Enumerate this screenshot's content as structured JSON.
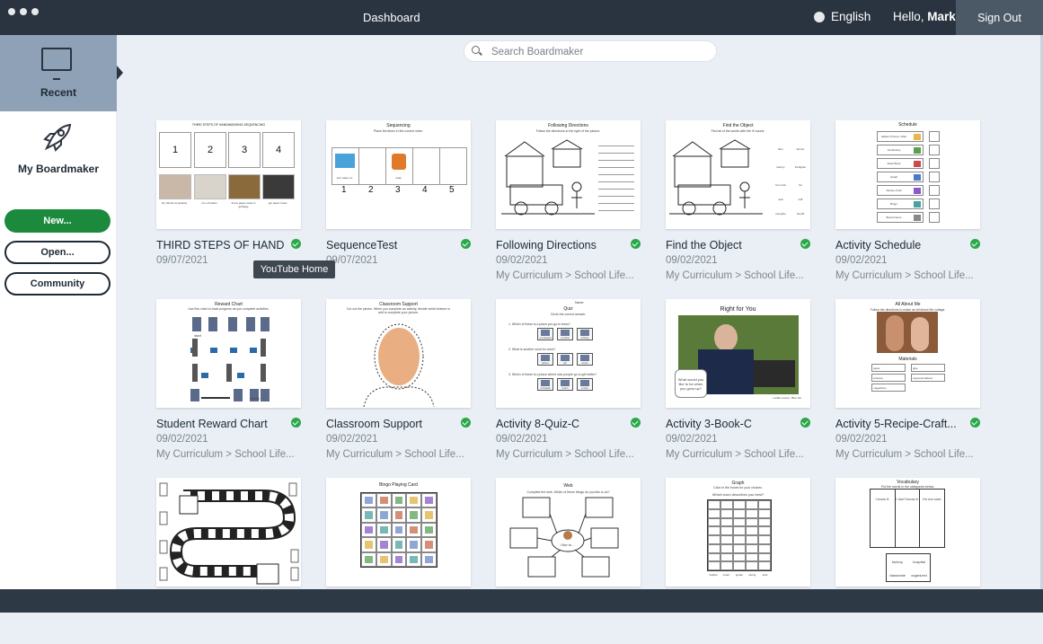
{
  "window": {
    "title": "Dashboard"
  },
  "topbar": {
    "language": "English",
    "greeting": "Hello,",
    "user": "Mark",
    "signout": "Sign Out"
  },
  "sidebar": {
    "recent": "Recent",
    "my_boardmaker": "My Boardmaker",
    "new": "New...",
    "open": "Open...",
    "community": "Community"
  },
  "search": {
    "placeholder": "Search Boardmaker"
  },
  "tooltip": "YouTube Home",
  "cards": [
    {
      "title": "THIRD STEPS OF HAND...",
      "date": "09/07/2021",
      "path": ""
    },
    {
      "title": "SequenceTest",
      "date": "09/07/2021",
      "path": ""
    },
    {
      "title": "Following Directions",
      "date": "09/02/2021",
      "path": "My Curriculum > School Life..."
    },
    {
      "title": "Find the Object",
      "date": "09/02/2021",
      "path": "My Curriculum > School Life..."
    },
    {
      "title": "Activity Schedule",
      "date": "09/02/2021",
      "path": "My Curriculum > School Life..."
    },
    {
      "title": "Student Reward Chart",
      "date": "09/02/2021",
      "path": "My Curriculum > School Life..."
    },
    {
      "title": "Classroom Support",
      "date": "09/02/2021",
      "path": "My Curriculum > School Life..."
    },
    {
      "title": "Activity 8-Quiz-C",
      "date": "09/02/2021",
      "path": "My Curriculum > School Life..."
    },
    {
      "title": "Activity 3-Book-C",
      "date": "09/02/2021",
      "path": "My Curriculum > School Life..."
    },
    {
      "title": "Activity 5-Recipe-Craft...",
      "date": "09/02/2021",
      "path": "My Curriculum > School Life..."
    },
    {
      "title": "",
      "date": "",
      "path": ""
    },
    {
      "title": "",
      "date": "",
      "path": ""
    },
    {
      "title": "",
      "date": "",
      "path": ""
    },
    {
      "title": "",
      "date": "",
      "path": ""
    },
    {
      "title": "",
      "date": "",
      "path": ""
    }
  ],
  "thumbs": {
    "handwashing": {
      "heading": "THIRD STEPS OF HANDWASHING-SEQUENCING",
      "nums": [
        "1",
        "2",
        "3",
        "4"
      ],
      "captions": [
        "dry hands completely",
        "turn off water",
        "throw paper towel in garbage",
        "get paper towel"
      ]
    },
    "sequencing": {
      "heading": "Sequencing",
      "sub": "Place the items in the correct order.",
      "nums": [
        "1",
        "2",
        "3",
        "4",
        "5"
      ],
      "captions": [
        "turn water on",
        "soap"
      ]
    },
    "following": {
      "heading": "Following Directions",
      "sub": "Follow the directions to the right of the picture."
    },
    "findobject": {
      "heading": "Find the Object",
      "sub": "Find all of the words with the /f/ sound.",
      "labels": [
        "farm",
        "farmer",
        "factory",
        "firefighter",
        "fire truck",
        "fox",
        "leaf",
        "calf",
        "campfire",
        "sheriff"
      ]
    },
    "schedule": {
      "heading": "Schedule",
      "items": [
        "Hidden Picture / Web",
        "Vocabulary",
        "Read Book",
        "Graph",
        "Recipe-Craft",
        "Bingo",
        "Board Game"
      ]
    },
    "reward": {
      "heading": "Reward Chart",
      "sub": "Use this chart to track progress as you complete activities.",
      "start": "start",
      "finish": "finish"
    },
    "classroom": {
      "heading": "Classroom Support",
      "sub": "Cut out the pieces. When you complete an activity, decide which feature to add to complete your picture."
    },
    "quiz": {
      "name": "Name:",
      "heading": "Quiz",
      "sub": "Circle the correct answer.",
      "q": [
        "1. Which of these is a place you go to learn?",
        "2. What is another word for work?",
        "3. Which of these is a place where sick people go to get better?"
      ],
      "opts": [
        [
          "a restaurant",
          "a school",
          "a library"
        ],
        [
          "games",
          "job",
          "recess"
        ],
        [
          "a hospital",
          "a farm",
          "a store"
        ]
      ]
    },
    "book": {
      "heading": "Right for You",
      "bubble": "What would you like to be when you grow up?",
      "credit": "Lucille Louvel · Bloc Ink"
    },
    "allabout": {
      "heading": "All About Me",
      "sub": "Follow the directions to make an All About Me collage.",
      "materials": "Materials",
      "items": [
        "paper",
        "scissors",
        "magazines",
        "glue",
        "crayons/markers"
      ]
    },
    "bingo": {
      "heading": "Bingo Playing Card"
    },
    "web": {
      "heading": "Web",
      "sub": "Complete the web. Which of these things do you like to do?",
      "center": "I like to ..."
    },
    "graph": {
      "heading": "Graph",
      "sub": "Color in the boxes for your choices.",
      "q": "Which word describes you best?",
      "labels": [
        "helpful",
        "smart",
        "gentle",
        "caring",
        "kind"
      ]
    },
    "vocab": {
      "heading": "Vocabulary",
      "sub": "Put the words in the categories below.",
      "cols": [
        "I know it.",
        "I don't know it.",
        "I'm not sure."
      ],
      "words": [
        "factory",
        "hospital",
        "classmate",
        "organized"
      ]
    }
  }
}
